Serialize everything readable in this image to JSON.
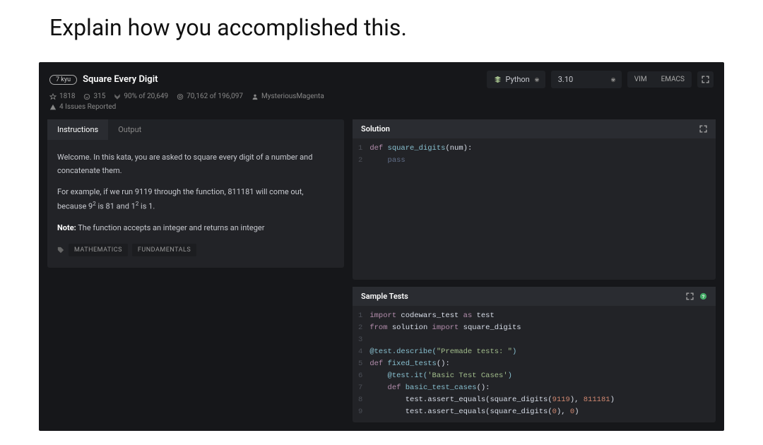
{
  "page_title": "Explain how you accomplished this.",
  "kata": {
    "kyu": "7 kyu",
    "title": "Square Every Digit",
    "stars": "1818",
    "satisfaction_votes": "315",
    "satisfaction_pct": "90% of 20,649",
    "completed": "70,162 of 196,097",
    "author": "MysteriousMagenta",
    "issues": "4 Issues Reported"
  },
  "selectors": {
    "language": "Python",
    "version": "3.10",
    "vim": "VIM",
    "emacs": "EMACS"
  },
  "tabs": {
    "instructions": "Instructions",
    "output": "Output"
  },
  "instructions": {
    "p1": "Welcome. In this kata, you are asked to square every digit of a number and concatenate them.",
    "p2_a": "For example, if we run 9119 through the function, 811181 will come out, because 9",
    "p2_b": " is 81 and 1",
    "p2_c": " is 1.",
    "p3_note": "Note:",
    "p3_body": " The function accepts an integer and returns an integer"
  },
  "tags": {
    "t1": "MATHEMATICS",
    "t2": "FUNDAMENTALS"
  },
  "editor": {
    "solution_title": "Solution",
    "tests_title": "Sample Tests",
    "solution_lines": {
      "l1": {
        "a": "def",
        "b": " ",
        "c": "square_digits",
        "d": "(num):"
      },
      "l2": "    pass"
    },
    "test_lines": {
      "l1": {
        "a": "import",
        "b": " codewars_test ",
        "c": "as",
        "d": " test"
      },
      "l2": {
        "a": "from",
        "b": " solution ",
        "c": "import",
        "d": " square_digits"
      },
      "l3": "",
      "l4": {
        "a": "@test.describe(",
        "b": "\"Premade tests: \"",
        "c": ")"
      },
      "l5": {
        "a": "def",
        "b": " ",
        "c": "fixed_tests",
        "d": "():"
      },
      "l6": {
        "a": "    @test.it(",
        "b": "'Basic Test Cases'",
        "c": ")"
      },
      "l7": {
        "a": "    ",
        "b": "def",
        "c": " ",
        "d": "basic_test_cases",
        "e": "():"
      },
      "l8": {
        "a": "        test.assert_equals(square_digits(",
        "b": "9119",
        "c": "), ",
        "d": "811181",
        "e": ")"
      },
      "l9": {
        "a": "        test.assert_equals(square_digits(",
        "b": "0",
        "c": "), ",
        "d": "0",
        "e": ")"
      }
    }
  }
}
